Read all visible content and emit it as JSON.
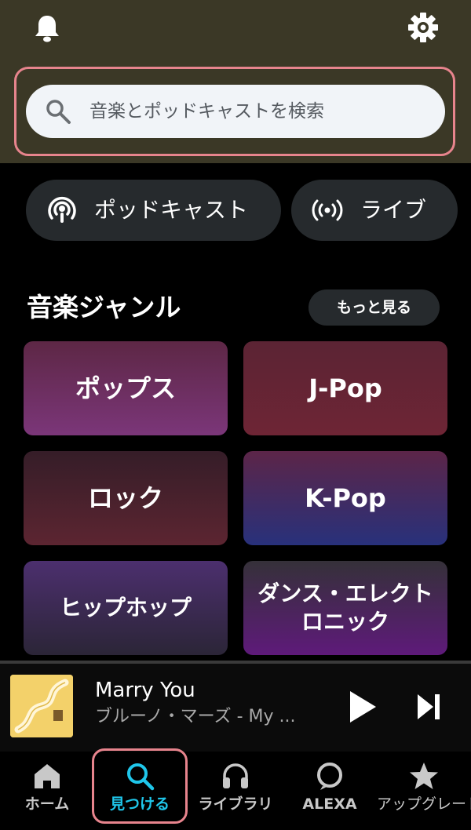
{
  "header": {
    "bell_icon": "bell-icon",
    "settings_icon": "gear-icon"
  },
  "search": {
    "placeholder": "音楽とポッドキャストを検索"
  },
  "quick_links": [
    {
      "label": "ポッドキャスト",
      "icon": "podcast-icon"
    },
    {
      "label": "ライブ",
      "icon": "live-broadcast-icon"
    }
  ],
  "genres": {
    "title": "音楽ジャンル",
    "more_label": "もっと見る",
    "tiles": [
      {
        "label": "ポップス"
      },
      {
        "label": "J-Pop"
      },
      {
        "label": "ロック"
      },
      {
        "label": "K-Pop"
      },
      {
        "label": "ヒップホップ"
      },
      {
        "label": "ダンス・エレクトロニック"
      }
    ]
  },
  "now_playing": {
    "title": "Marry You",
    "artist": "ブルーノ・マーズ - My ..."
  },
  "bottom_nav": [
    {
      "label": "ホーム",
      "icon": "home-icon"
    },
    {
      "label": "見つける",
      "icon": "search-icon",
      "active": true
    },
    {
      "label": "ライブラリ",
      "icon": "headphones-icon"
    },
    {
      "label": "ALEXA",
      "icon": "alexa-icon"
    },
    {
      "label": "アップグレード",
      "icon": "star-icon"
    }
  ],
  "colors": {
    "header_bg": "#3b3826",
    "highlight_outline": "#e7848d",
    "active_nav": "#1fc6ea"
  }
}
